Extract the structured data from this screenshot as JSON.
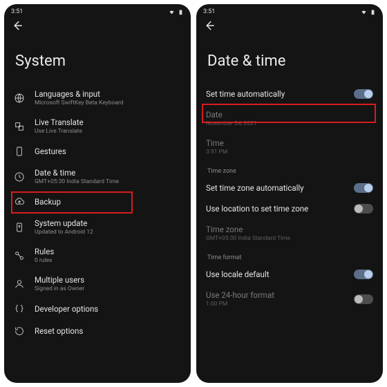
{
  "statusbar_time": "3:51",
  "left": {
    "title": "System",
    "items": [
      {
        "icon": "globe-icon",
        "label": "Languages & input",
        "sub": "Microsoft SwiftKey Beta Keyboard"
      },
      {
        "icon": "translate-icon",
        "label": "Live Translate",
        "sub": "Use Live Translate"
      },
      {
        "icon": "gesture-icon",
        "label": "Gestures",
        "sub": ""
      },
      {
        "icon": "clock-icon",
        "label": "Date & time",
        "sub": "GMT+05:30 India Standard Time"
      },
      {
        "icon": "backup-icon",
        "label": "Backup",
        "sub": ""
      },
      {
        "icon": "update-icon",
        "label": "System update",
        "sub": "Updated to Android 12"
      },
      {
        "icon": "rules-icon",
        "label": "Rules",
        "sub": "0 rules"
      },
      {
        "icon": "users-icon",
        "label": "Multiple users",
        "sub": "Signed in as Owner"
      },
      {
        "icon": "braces-icon",
        "label": "Developer options",
        "sub": ""
      },
      {
        "icon": "reset-icon",
        "label": "Reset options",
        "sub": ""
      }
    ]
  },
  "right": {
    "title": "Date & time",
    "set_time_auto": {
      "label": "Set time automatically",
      "on": true
    },
    "date": {
      "label": "Date",
      "sub": "November 24, 2021"
    },
    "time": {
      "label": "Time",
      "sub": "3:51 PM"
    },
    "section_tz": "Time zone",
    "set_tz_auto": {
      "label": "Set time zone automatically",
      "on": true
    },
    "use_location": {
      "label": "Use location to set time zone",
      "on": false
    },
    "tz": {
      "label": "Time zone",
      "sub": "GMT+05:30 India Standard Time"
    },
    "section_fmt": "Time format",
    "locale_default": {
      "label": "Use locale default",
      "on": true
    },
    "use_24h": {
      "label": "Use 24-hour format",
      "sub": "1:00 PM",
      "on": false
    }
  }
}
